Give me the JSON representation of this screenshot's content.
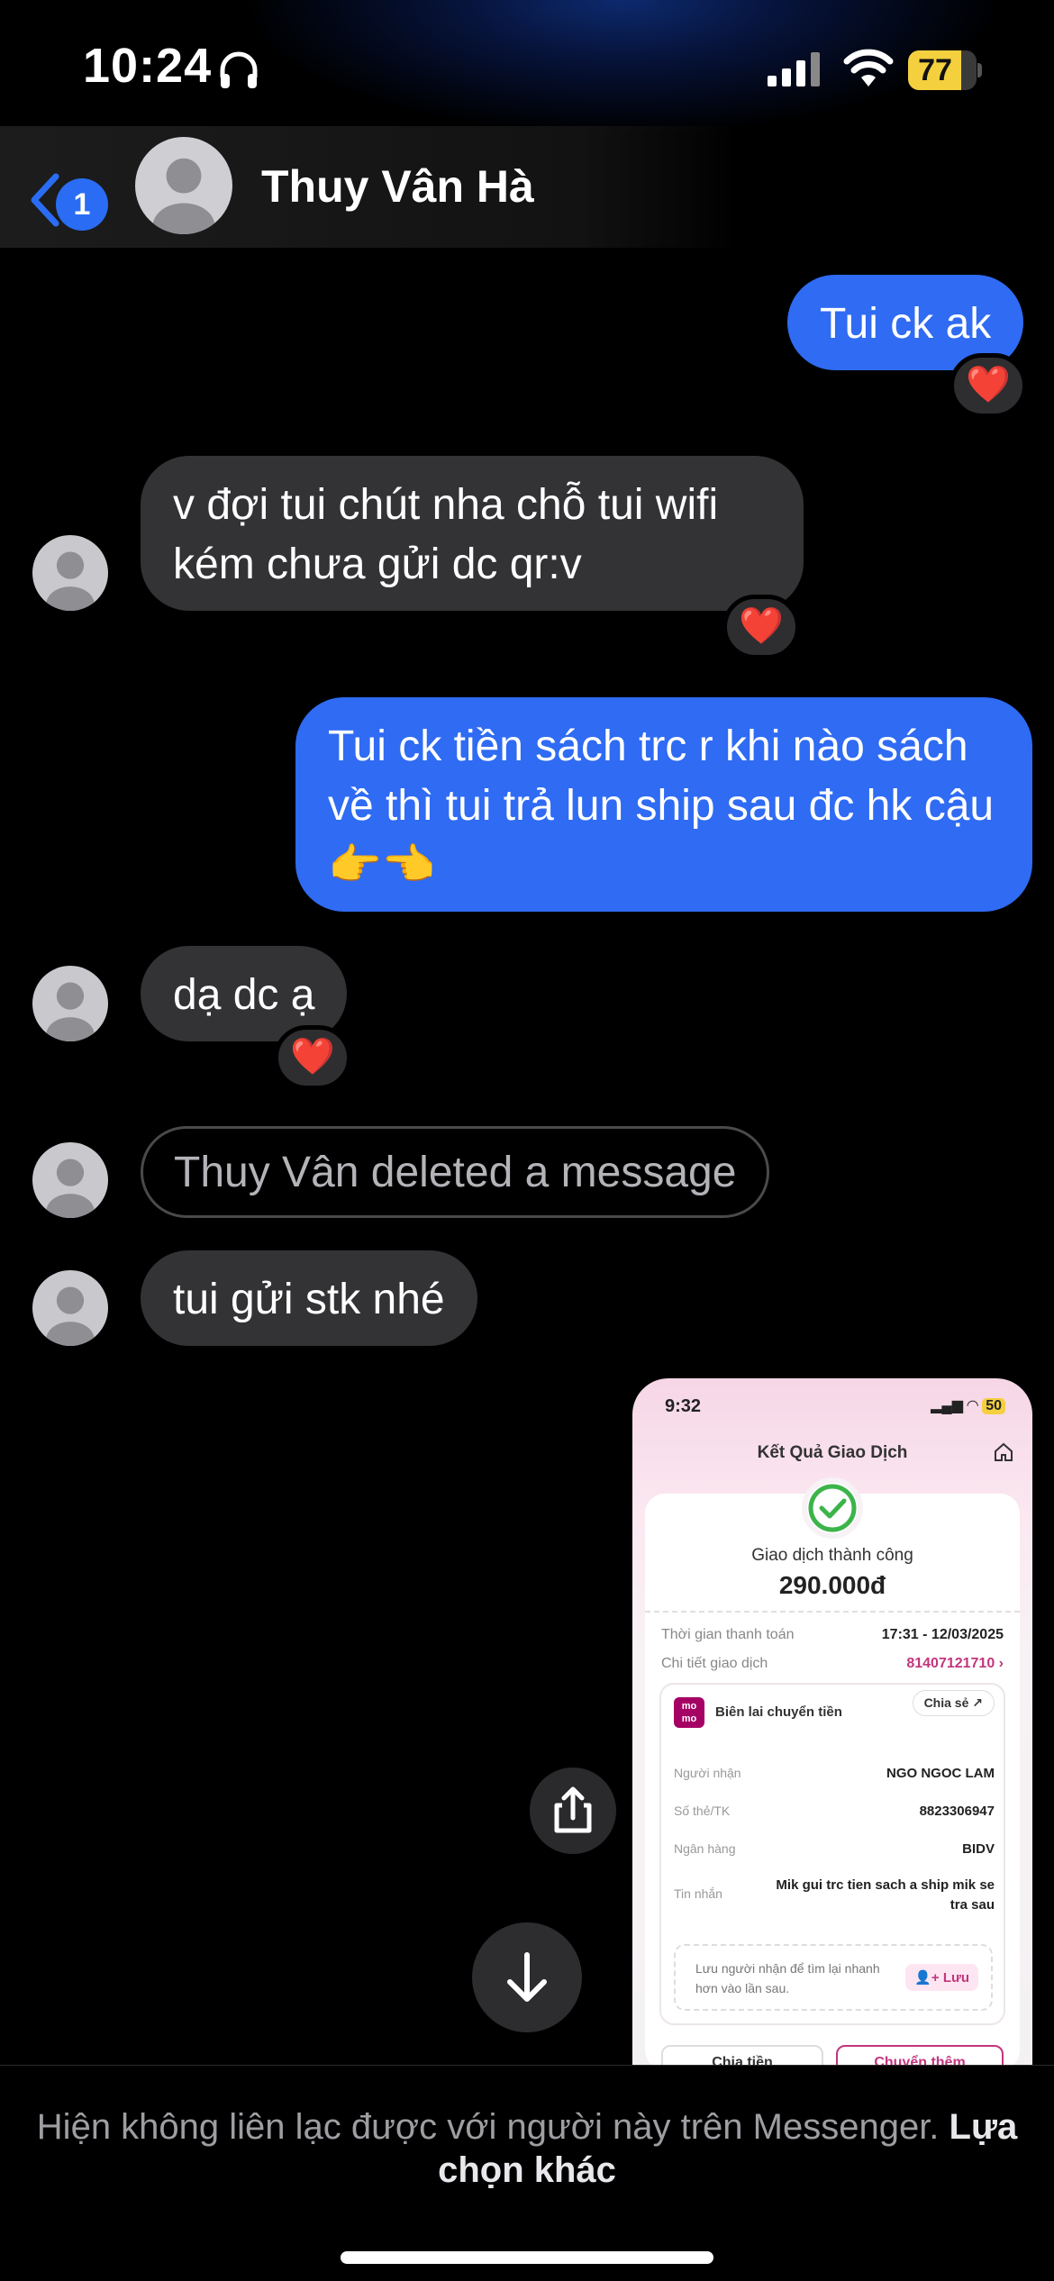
{
  "status_bar": {
    "time": "10:24",
    "battery": "77",
    "battery_fraction": 0.77
  },
  "header": {
    "back_badge": "1",
    "contact_name": "Thuy Vân Hà"
  },
  "messages": [
    {
      "text": "Tui ck ak",
      "reaction": "❤️"
    },
    {
      "text": "v đợi tui chút nha chỗ tui wifi kém chưa gửi dc qr:v",
      "reaction": "❤️"
    },
    {
      "text": "Tui ck tiền sách trc r khi nào sách về thì tui trả lun ship sau đc hk cậu 👉👈"
    },
    {
      "text": "dạ dc ạ",
      "reaction": "❤️"
    },
    {
      "text": "Thuy Vân deleted a message"
    },
    {
      "text": "tui gửi stk nhé"
    }
  ],
  "receipt": {
    "time": "9:32",
    "battery": "50",
    "title": "Kết Quả Giao Dịch",
    "status": "Giao dịch thành công",
    "amount": "290.000đ",
    "rows": [
      {
        "label": "Thời gian thanh toán",
        "value": "17:31 - 12/03/2025"
      },
      {
        "label": "Chi tiết giao dịch",
        "value": "81407121710 ›"
      }
    ],
    "logo": "mo mo",
    "box_title": "Biên lai chuyển tiền",
    "share": "Chia sẻ",
    "fields": [
      {
        "label": "Người nhận",
        "value": "NGO NGOC LAM"
      },
      {
        "label": "Số thẻ/TK",
        "value": "8823306947"
      },
      {
        "label": "Ngân hàng",
        "value": "BIDV"
      },
      {
        "label": "Tin nhắn",
        "value": "Mik gui trc tien sach a ship mik se tra sau"
      }
    ],
    "save_text": "Lưu người nhận để tìm lại nhanh hơn vào lần sau.",
    "save_button": "Lưu",
    "button_left": "Chia tiền",
    "button_right": "Chuyển thêm"
  },
  "footer": {
    "text": "Hiện không liên lạc được với người này trên Messenger.",
    "link": "Lựa chọn khác"
  },
  "colors": {
    "outgoing": "#2f6bf3",
    "incoming": "#333335",
    "badge": "#2a6df4",
    "accent_pink": "#c2367d"
  }
}
